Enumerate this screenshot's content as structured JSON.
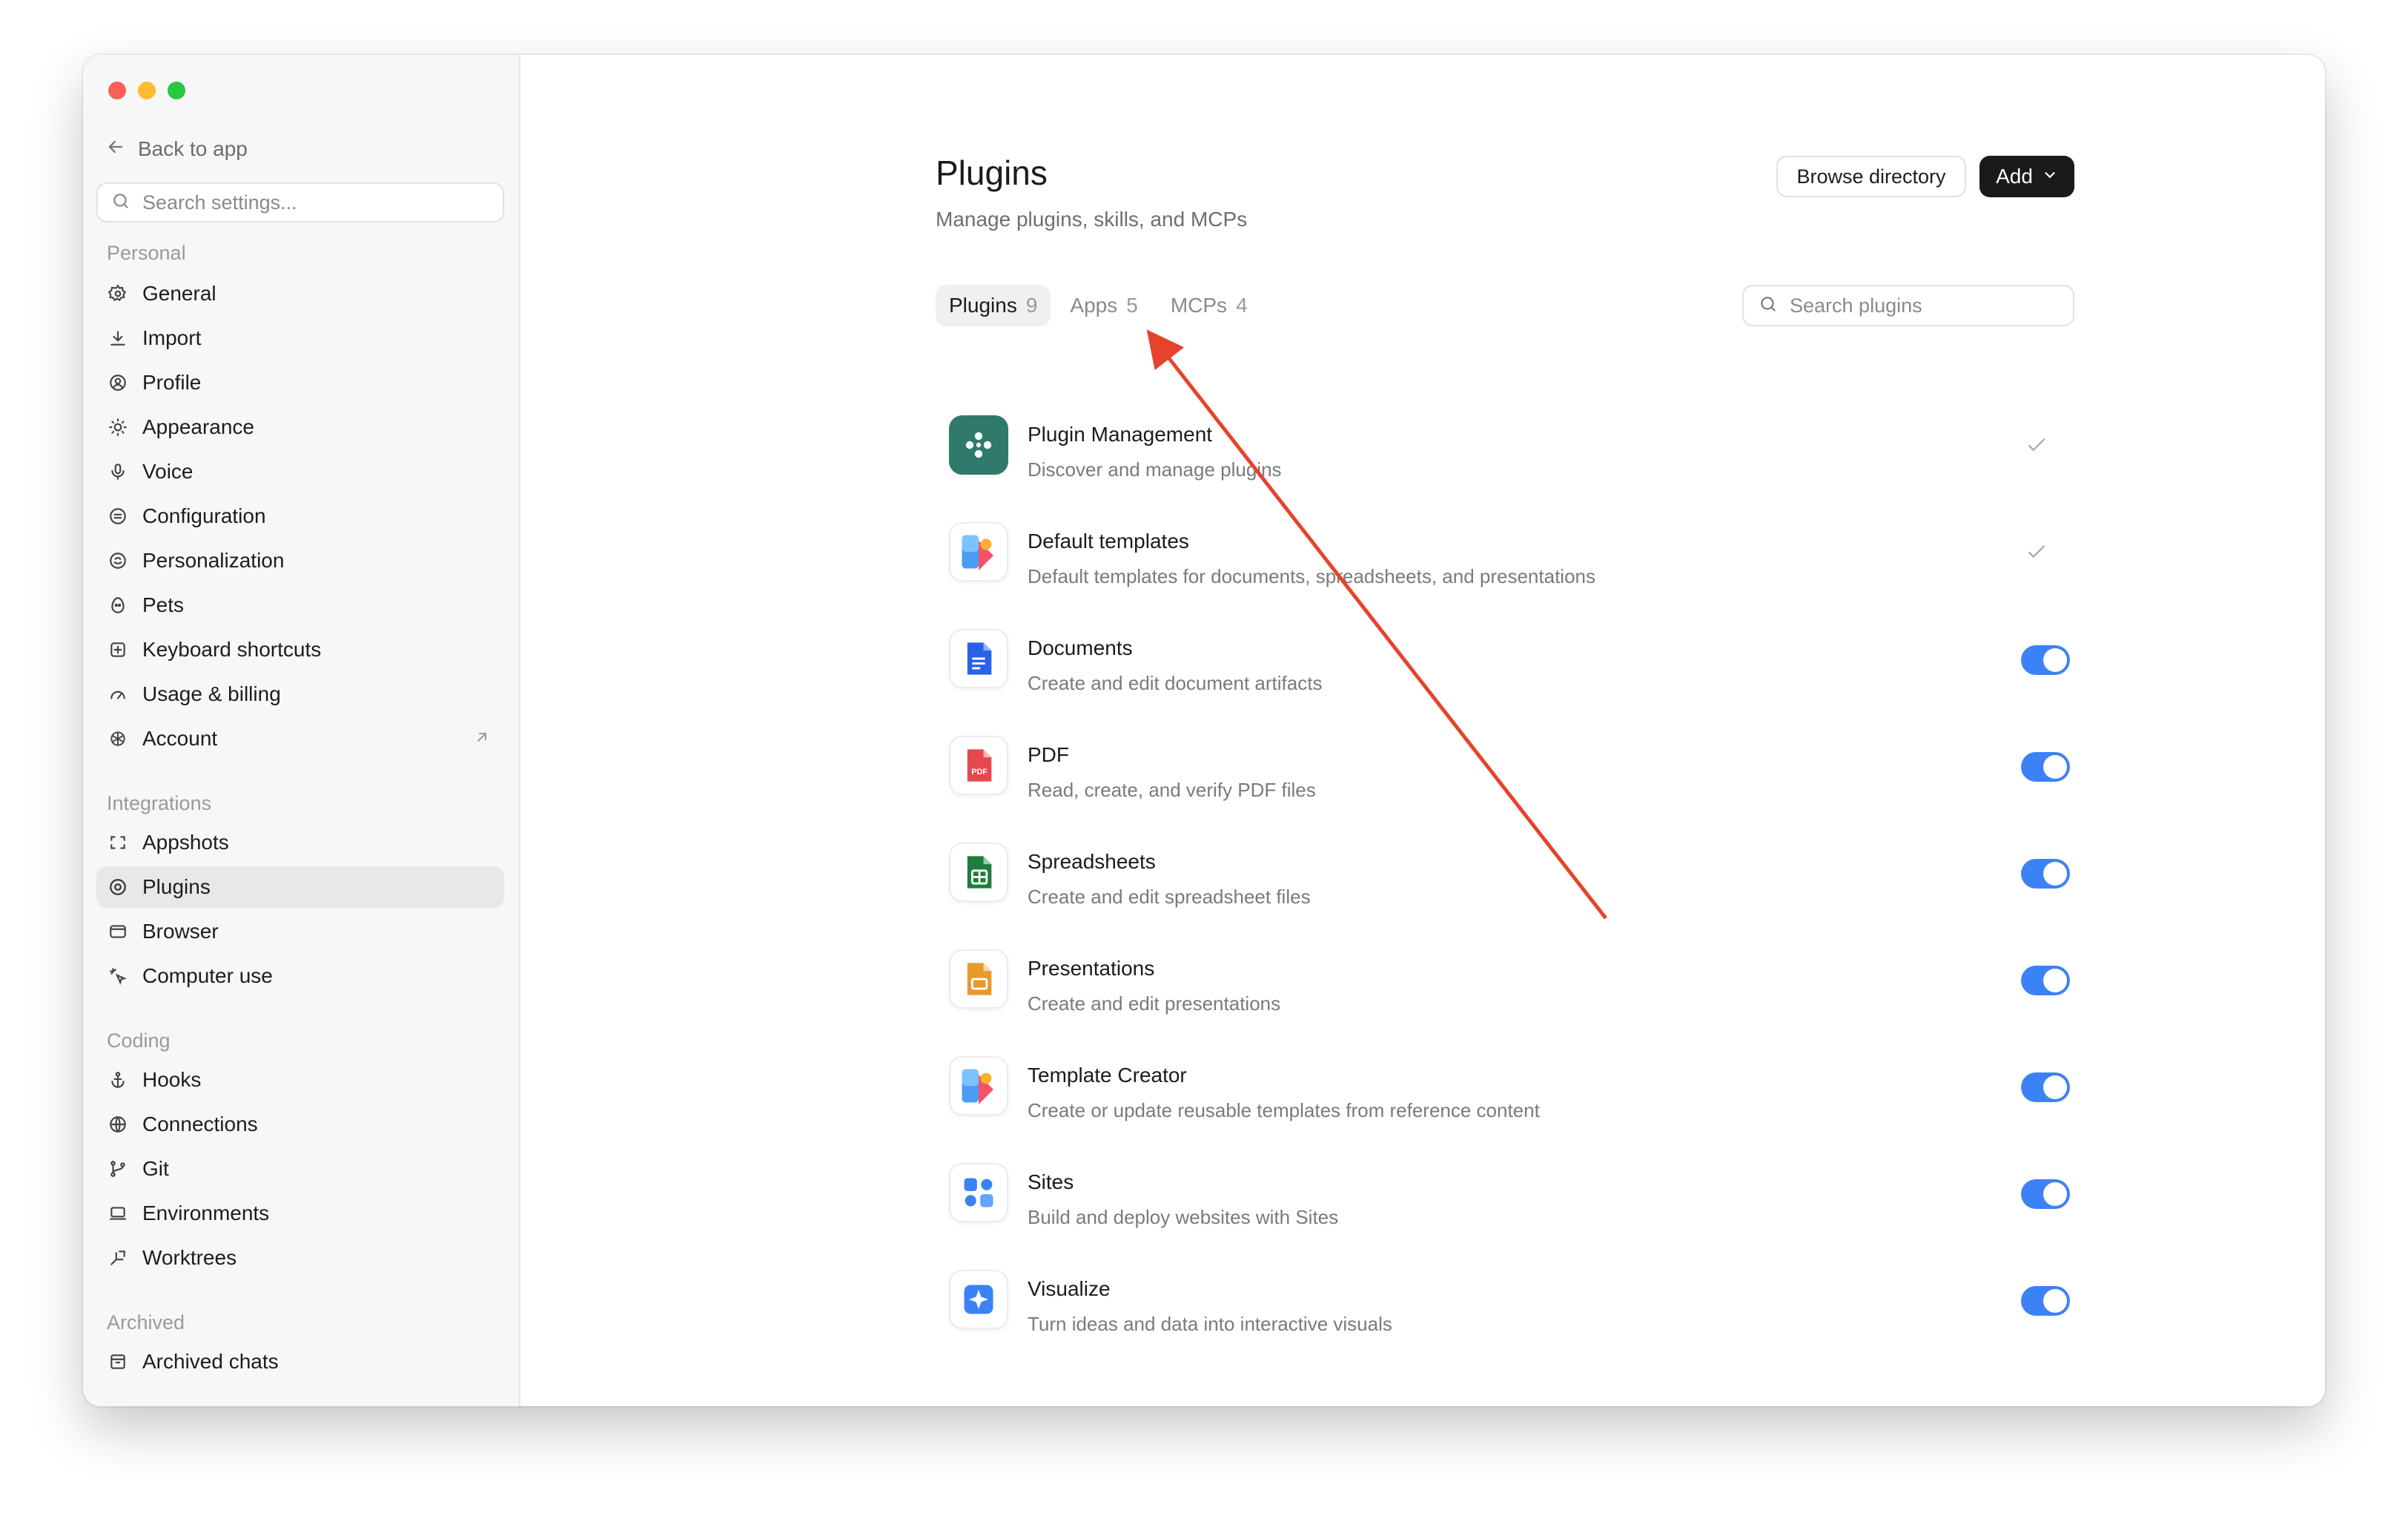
{
  "sidebar": {
    "back_label": "Back to app",
    "search_placeholder": "Search settings...",
    "sections": [
      {
        "label": "Personal",
        "items": [
          {
            "label": "General",
            "icon": "gear-icon"
          },
          {
            "label": "Import",
            "icon": "download-icon"
          },
          {
            "label": "Profile",
            "icon": "person-circle-icon"
          },
          {
            "label": "Appearance",
            "icon": "sun-icon"
          },
          {
            "label": "Voice",
            "icon": "microphone-icon"
          },
          {
            "label": "Configuration",
            "icon": "sliders-circle-icon"
          },
          {
            "label": "Personalization",
            "icon": "sparkle-circle-icon"
          },
          {
            "label": "Pets",
            "icon": "egg-icon"
          },
          {
            "label": "Keyboard shortcuts",
            "icon": "keyboard-plus-icon"
          },
          {
            "label": "Usage & billing",
            "icon": "gauge-icon"
          },
          {
            "label": "Account",
            "icon": "openai-icon"
          }
        ]
      },
      {
        "label": "Integrations",
        "items": [
          {
            "label": "Appshots",
            "icon": "screenshot-frame-icon"
          },
          {
            "label": "Plugins",
            "icon": "plugin-at-icon"
          },
          {
            "label": "Browser",
            "icon": "browser-window-icon"
          },
          {
            "label": "Computer use",
            "icon": "cursor-sparkle-icon"
          }
        ]
      },
      {
        "label": "Coding",
        "items": [
          {
            "label": "Hooks",
            "icon": "anchor-icon"
          },
          {
            "label": "Connections",
            "icon": "globe-icon"
          },
          {
            "label": "Git",
            "icon": "git-branch-icon"
          },
          {
            "label": "Environments",
            "icon": "laptop-icon"
          },
          {
            "label": "Worktrees",
            "icon": "worktree-icon"
          }
        ]
      },
      {
        "label": "Archived",
        "items": [
          {
            "label": "Archived chats",
            "icon": "archive-box-icon"
          }
        ]
      }
    ]
  },
  "header": {
    "title": "Plugins",
    "subtitle": "Manage plugins, skills, and MCPs",
    "browse_label": "Browse directory",
    "add_label": "Add"
  },
  "tabs": [
    {
      "label": "Plugins",
      "count": "9"
    },
    {
      "label": "Apps",
      "count": "5"
    },
    {
      "label": "MCPs",
      "count": "4"
    }
  ],
  "search": {
    "placeholder": "Search plugins"
  },
  "plugins": [
    {
      "name": "Plugin Management",
      "desc": "Discover and manage plugins",
      "control": "check",
      "icon": "plugin-management-icon"
    },
    {
      "name": "Default templates",
      "desc": "Default templates for documents, spreadsheets, and presentations",
      "control": "check",
      "icon": "templates-icon"
    },
    {
      "name": "Documents",
      "desc": "Create and edit document artifacts",
      "control": "toggle",
      "enabled": true,
      "icon": "document-icon"
    },
    {
      "name": "PDF",
      "desc": "Read, create, and verify PDF files",
      "control": "toggle",
      "enabled": true,
      "icon": "pdf-icon",
      "icon_text": "PDF"
    },
    {
      "name": "Spreadsheets",
      "desc": "Create and edit spreadsheet files",
      "control": "toggle",
      "enabled": true,
      "icon": "spreadsheet-icon"
    },
    {
      "name": "Presentations",
      "desc": "Create and edit presentations",
      "control": "toggle",
      "enabled": true,
      "icon": "presentation-icon"
    },
    {
      "name": "Template Creator",
      "desc": "Create or update reusable templates from reference content",
      "control": "toggle",
      "enabled": true,
      "icon": "template-creator-icon"
    },
    {
      "name": "Sites",
      "desc": "Build and deploy websites with Sites",
      "control": "toggle",
      "enabled": true,
      "icon": "sites-icon"
    },
    {
      "name": "Visualize",
      "desc": "Turn ideas and data into interactive visuals",
      "control": "toggle",
      "enabled": true,
      "icon": "visualize-icon"
    }
  ],
  "colors": {
    "accent": "#3b82f6",
    "annotation_arrow": "#e5432c",
    "traffic_red": "#ff5f57",
    "traffic_yellow": "#febc2e",
    "traffic_green": "#28c840"
  }
}
